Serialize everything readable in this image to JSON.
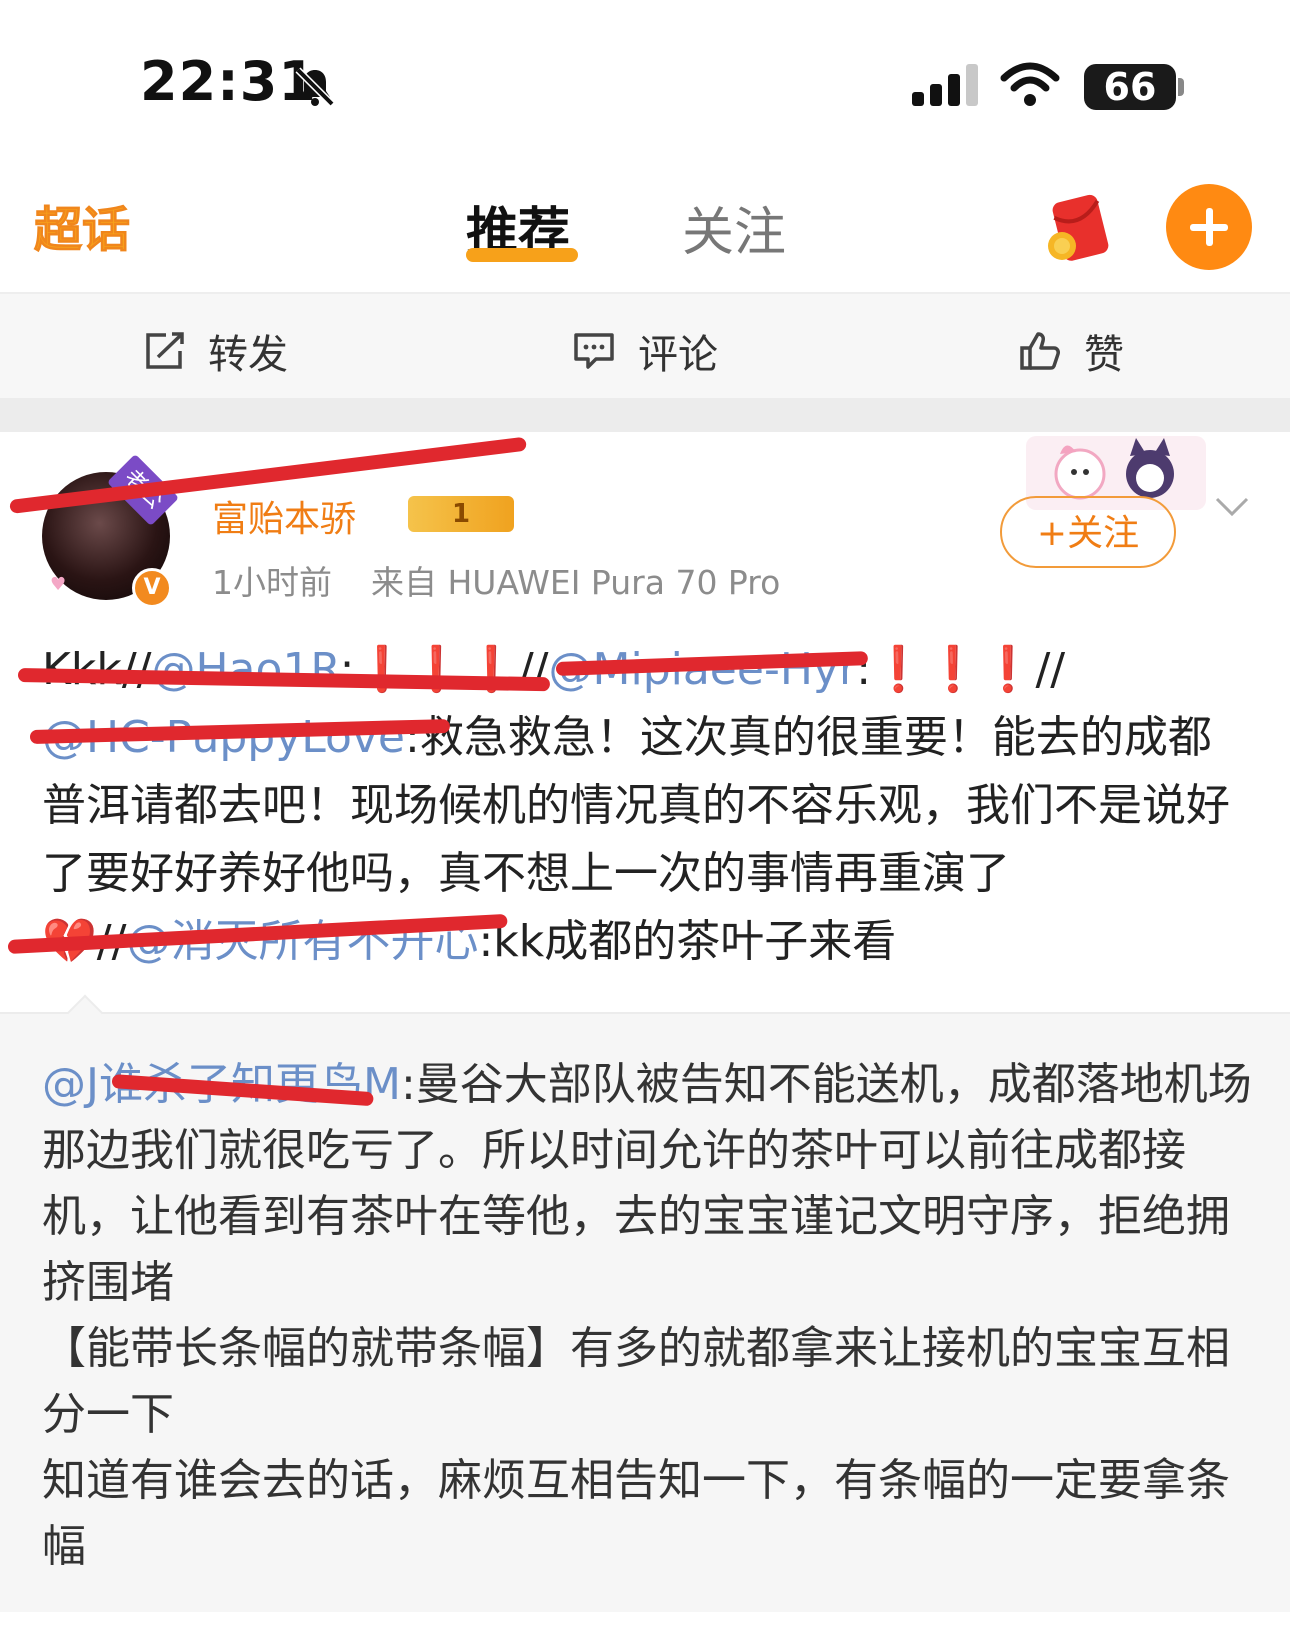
{
  "status_bar": {
    "time": "22:31",
    "battery": "66",
    "icons": [
      "bell-muted-icon",
      "signal-icon",
      "wifi-icon",
      "battery-icon"
    ]
  },
  "top_nav": {
    "logo_text": "超话",
    "tabs": [
      {
        "label": "推荐",
        "active": true
      },
      {
        "label": "关注",
        "active": false
      }
    ],
    "accent": "#f7a11a",
    "plus_color": "#ff8a12"
  },
  "actions": {
    "repost": "转发",
    "comment": "评论",
    "like": "赞"
  },
  "post": {
    "avatar_tag": "老公",
    "username": "富贻本骄",
    "level": "1",
    "time_ago": "1小时前",
    "source": "来自 HUAWEI Pura 70 Pro",
    "follow_label": "+关注",
    "body": {
      "seg1": "Kkk//",
      "mention1": "@Hao1R",
      "seg2": ":",
      "exc1": "❗❗❗",
      "seg3": "//",
      "mention2": "@Mipiaee-Hyr",
      "seg4": ":",
      "exc2": "❗❗❗",
      "seg5": "//",
      "mention3": "@HC-PuppyLove",
      "seg6": ":救急救急！这次真的很重要！能去的成都普洱请都去吧！现场候机的情况真的不容乐观，我们不是说好了要好好养好他吗，真不想上一次的事情再重演了",
      "heart": "💔",
      "seg7": "//",
      "mention4": "@消灭所有不开心",
      "seg8": ":kk成都的茶叶子来看"
    }
  },
  "quote": {
    "mention": "@J谁杀了知更鸟M",
    "line1": ":曼谷大部队被告知不能送机，成都落地机场那边我们就很吃亏了。所以时间允许的茶叶可以前往成都接机，让他看到有茶叶在等他，去的宝宝谨记文明守序，拒绝拥挤围堵",
    "line2": "【能带长条幅的就带条幅】有多的就都拿来让接机的宝宝互相分一下",
    "line3": "知道有谁会去的话，麻烦互相告知一下，有条幅的一定要拿条幅"
  }
}
